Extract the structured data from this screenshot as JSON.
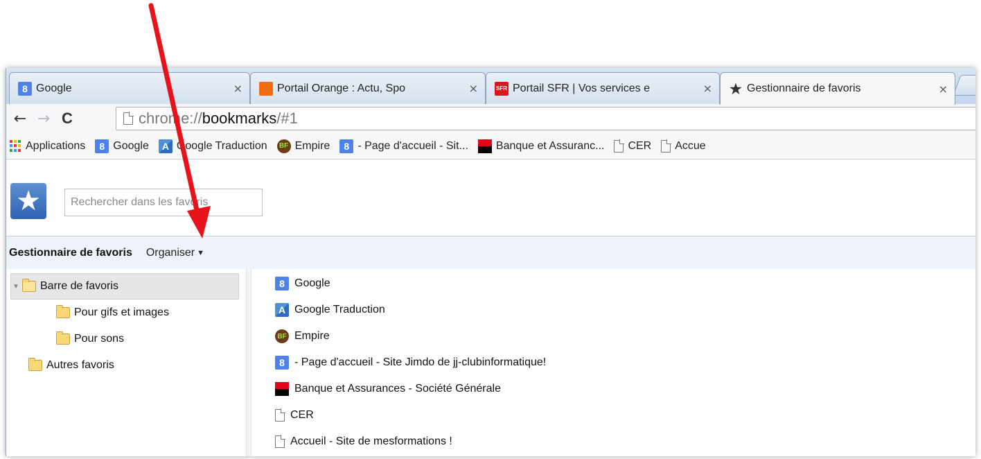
{
  "tabs": [
    {
      "title": "Google",
      "icon": "google-icon",
      "close": "×"
    },
    {
      "title": "Portail Orange : Actu, Spo",
      "icon": "orange-icon",
      "close": "×"
    },
    {
      "title": "Portail SFR | Vos services e",
      "icon": "sfr-icon",
      "icon_text": "SFR",
      "close": "×"
    },
    {
      "title": "Gestionnaire de favoris",
      "icon": "star-icon",
      "close": "×"
    }
  ],
  "toolbar": {
    "back_icon": "←",
    "forward_icon": "→",
    "reload_icon": "C",
    "url_scheme": "chrome://",
    "url_host": "bookmarks",
    "url_path": "/#1"
  },
  "bookmarks_bar": [
    {
      "label": "Applications",
      "icon": "apps-icon"
    },
    {
      "label": "Google",
      "icon": "google-icon"
    },
    {
      "label": "Google Traduction",
      "icon": "translate-icon"
    },
    {
      "label": "Empire",
      "icon": "empire-icon"
    },
    {
      "label": "- Page d'accueil - Sit...",
      "icon": "google-icon"
    },
    {
      "label": "Banque et Assuranc...",
      "icon": "societe-generale-icon"
    },
    {
      "label": "CER",
      "icon": "page-icon"
    },
    {
      "label": "Accue",
      "icon": "page-icon"
    }
  ],
  "manager": {
    "search_placeholder": "Rechercher dans les favoris",
    "title": "Gestionnaire de favoris",
    "organise_label": "Organiser",
    "tree": [
      {
        "label": "Barre de favoris",
        "selected": true,
        "expanded": true
      },
      {
        "label": "Pour gifs et images"
      },
      {
        "label": "Pour sons"
      },
      {
        "label": "Autres favoris"
      }
    ],
    "items": [
      {
        "label": "Google",
        "icon": "google-icon"
      },
      {
        "label": "Google Traduction",
        "icon": "translate-icon"
      },
      {
        "label": "Empire",
        "icon": "empire-icon"
      },
      {
        "label": "- Page d'accueil - Site Jimdo de jj-clubinformatique!",
        "icon": "google-icon"
      },
      {
        "label": "Banque et Assurances - Société Générale",
        "icon": "societe-generale-icon"
      },
      {
        "label": "CER",
        "icon": "page-icon"
      },
      {
        "label": "Accueil - Site de mesformations !",
        "icon": "page-icon"
      }
    ]
  },
  "colors": {
    "annotation_arrow": "#e8131a",
    "google_blue": "#4f82e8",
    "header_bar": "#eef3fb"
  }
}
